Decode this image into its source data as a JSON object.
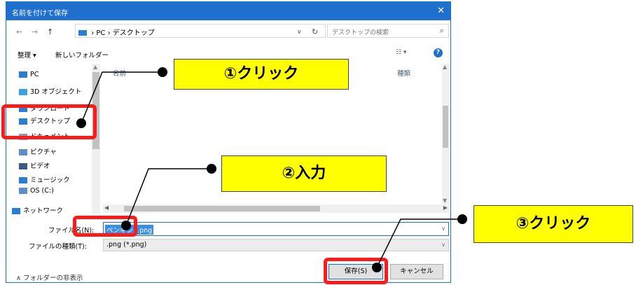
{
  "dialog": {
    "title": "名前を付けて保存",
    "close_glyph": "✕"
  },
  "address_bar": {
    "back_glyph": "←",
    "forward_glyph": "→",
    "up_glyph": "↑",
    "path_pc": "PC",
    "separator": "›",
    "path_folder": "デスクトップ",
    "dropdown_glyph": "∨",
    "refresh_glyph": "↻",
    "search_placeholder": "デスクトップの検索",
    "search_glyph": "⌕"
  },
  "toolbar": {
    "organize_label": "整理 ▾",
    "new_folder_label": "新しいフォルダー",
    "view_glyph": "☷ ▾",
    "help_glyph": "?"
  },
  "nav_pane": {
    "items": [
      {
        "label": "PC",
        "icon": "pc-icon",
        "color": "#2a7fd4"
      },
      {
        "label": "3D オブジェクト",
        "icon": "cube-icon",
        "color": "#3aa0e8"
      },
      {
        "label": "ダウンロード",
        "icon": "download-icon",
        "color": "#2a7fd4"
      },
      {
        "label": "デスクトップ",
        "icon": "desktop-icon",
        "color": "#2a7fd4"
      },
      {
        "label": "ドキュメント",
        "icon": "document-icon",
        "color": "#8a9bb0"
      },
      {
        "label": "ピクチャ",
        "icon": "picture-icon",
        "color": "#5a8fc8"
      },
      {
        "label": "ビデオ",
        "icon": "video-icon",
        "color": "#3b5b86"
      },
      {
        "label": "ミュージック",
        "icon": "music-icon",
        "color": "#2a7fd4"
      },
      {
        "label": "OS (C:)",
        "icon": "drive-icon",
        "color": "#5a8fc8"
      },
      {
        "label": "ネットワーク",
        "icon": "network-icon",
        "color": "#2a7fd4"
      }
    ]
  },
  "file_list": {
    "column_name": "名前",
    "column_type": "種類"
  },
  "form": {
    "filename_label": "ファイル名(N):",
    "filename_value": "ペンギン1.png",
    "filetype_label": "ファイルの種類(T):",
    "filetype_value": ".png (*.png)"
  },
  "footer": {
    "hide_folders": "∧  フォルダーの非表示",
    "save_button": "保存(S)",
    "cancel_button": "キャンセル"
  },
  "annotations": {
    "step1": "①クリック",
    "step2": "②入力",
    "step3": "③クリック",
    "highlight_color": "#ff1a1a",
    "callout_color": "#ffff00"
  }
}
